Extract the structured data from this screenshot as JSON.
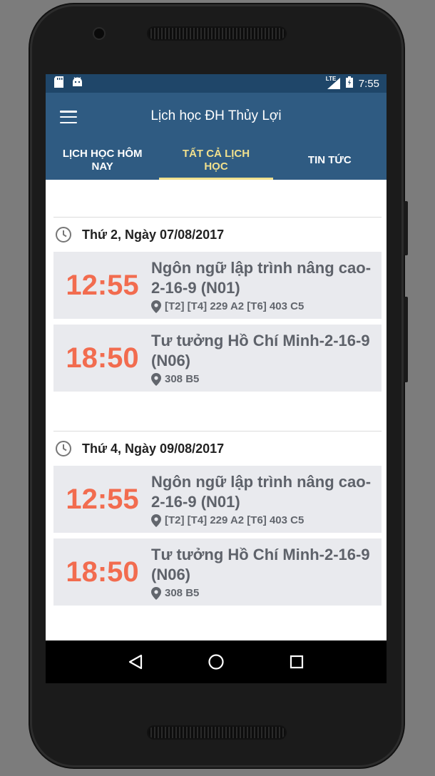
{
  "status_bar": {
    "left_icons": [
      "sd-card-icon",
      "android-icon"
    ],
    "network_label": "LTE",
    "time": "7:55"
  },
  "app_bar": {
    "title": "Lịch học ĐH Thủy Lợi",
    "color": "#2f5b82"
  },
  "tabs": [
    {
      "label": "LỊCH HỌC HÔM NAY",
      "active": false
    },
    {
      "label": "TẤT CẢ LỊCH HỌC",
      "active": true
    },
    {
      "label": "TIN TỨC",
      "active": false
    }
  ],
  "days": [
    {
      "title": "Thứ 2, Ngày 07/08/2017",
      "classes": [
        {
          "time": "12:55",
          "name": "Ngôn ngữ lập trình nâng cao-2-16-9 (N01)",
          "room": "[T2] [T4] 229 A2 [T6] 403 C5"
        },
        {
          "time": "18:50",
          "name": "Tư tưởng Hồ Chí Minh-2-16-9 (N06)",
          "room": "308 B5"
        }
      ]
    },
    {
      "title": "Thứ 4, Ngày 09/08/2017",
      "classes": [
        {
          "time": "12:55",
          "name": "Ngôn ngữ lập trình nâng cao-2-16-9 (N01)",
          "room": "[T2] [T4] 229 A2 [T6] 403 C5"
        },
        {
          "time": "18:50",
          "name": "Tư tưởng Hồ Chí Minh-2-16-9 (N06)",
          "room": "308 B5"
        }
      ]
    }
  ],
  "colors": {
    "status_bar": "#1f4669",
    "tab_active": "#f1e08d",
    "time_accent": "#f26c4f",
    "card_background": "#e9eaee"
  },
  "nav_bar": [
    "back-icon",
    "home-icon",
    "recents-icon"
  ]
}
